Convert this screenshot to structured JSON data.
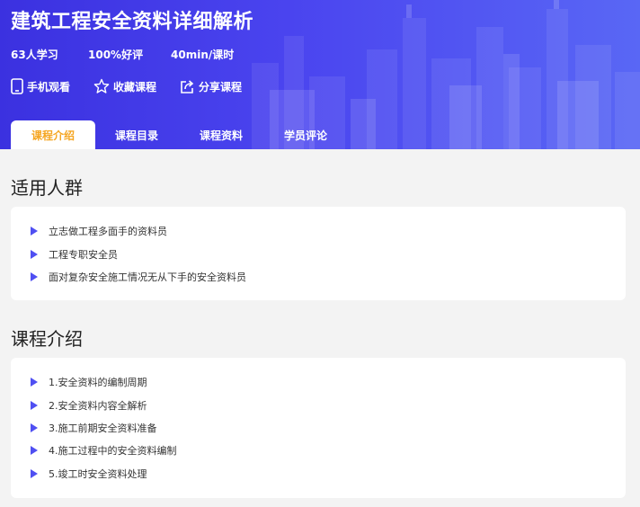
{
  "header": {
    "title": "建筑工程安全资料详细解析",
    "stats": {
      "learners": "63人学习",
      "rating": "100%好评",
      "duration": "40min/课时"
    },
    "actions": {
      "mobile": "手机观看",
      "favorite": "收藏课程",
      "share": "分享课程"
    },
    "tabs": [
      "课程介绍",
      "课程目录",
      "课程资料",
      "学员评论"
    ],
    "active_tab": 0
  },
  "audience": {
    "title": "适用人群",
    "items": [
      "立志做工程多面手的资料员",
      "工程专职安全员",
      "面对复杂安全施工情况无从下手的安全资料员"
    ]
  },
  "intro": {
    "title": "课程介绍",
    "items": [
      "1.安全资料的编制周期",
      "2.安全资料内容全解析",
      "3.施工前期安全资料准备",
      "4.施工过程中的安全资料编制",
      "5.竣工时安全资料处理"
    ]
  },
  "colors": {
    "hero_start": "#3b31e0",
    "hero_end": "#5967f5",
    "accent": "#f5a623",
    "bullet": "#4f4ff2"
  },
  "icons": {
    "mobile": "phone-icon",
    "favorite": "star-icon",
    "share": "share-icon",
    "bullet": "triangle-right-icon"
  }
}
